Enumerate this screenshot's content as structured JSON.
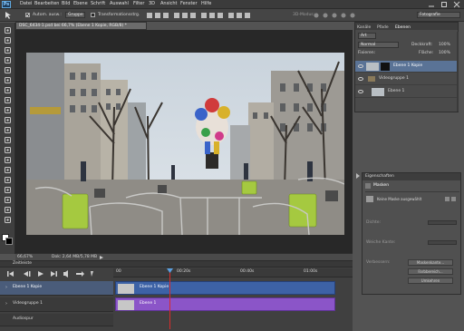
{
  "app": {
    "logo": "Ps"
  },
  "menubar": {
    "items": [
      "Datei",
      "Bearbeiten",
      "Bild",
      "Ebene",
      "Schrift",
      "Auswahl",
      "Filter",
      "3D",
      "Ansicht",
      "Fenster",
      "Hilfe"
    ]
  },
  "options": {
    "auto_select_label": "Autom. ausw.:",
    "auto_select_value": "Gruppe",
    "transform_label": "Transformationsstrg.",
    "mode_3d": "3D-Modus:",
    "workspace": "Fotografie"
  },
  "document": {
    "tab_title": "DSC_6434-1.psd bei 66,7% (Ebene 1 Kopie, RGB/8) *",
    "zoom": "66,67%",
    "doc_size": "Dok: 2,64 MB/5,78 MB"
  },
  "timeline": {
    "title": "Zeitleiste",
    "time_marks": [
      "00",
      "00:20s",
      "00:40s",
      "01:00s"
    ],
    "tracks": [
      {
        "name": "Ebene 1 Kopie",
        "clip": "Ebene 1 Kopie"
      },
      {
        "name": "Videogruppe 1",
        "clip": "Ebene 1"
      },
      {
        "name": "Audiospur",
        "clip": ""
      }
    ]
  },
  "panels": {
    "tabs": [
      "Kanäle",
      "Pfade",
      "Ebenen"
    ],
    "filter_kind": "Art",
    "blend_mode": "Normal",
    "opacity_label": "Deckkraft:",
    "opacity_value": "100%",
    "lock_label": "Fixieren:",
    "fill_label": "Fläche:",
    "fill_value": "100%",
    "layers": [
      {
        "name": "Ebene 1 Kopie",
        "selected": true
      },
      {
        "name": "Videogruppe 1",
        "selected": false
      },
      {
        "name": "Ebene 1",
        "selected": false
      }
    ]
  },
  "properties": {
    "title": "Eigenschaften",
    "tab": "Masken",
    "no_mask": "Keine Maske ausgewählt",
    "density_label": "Dichte:",
    "feather_label": "Weiche Kante:",
    "refine_label": "Verbessern:",
    "buttons": [
      "Maskenkante...",
      "Farbbereich...",
      "Umkehren"
    ]
  },
  "colors": {
    "accent_blue": "#3d62a6",
    "clip_purple": "#8b55c8",
    "playhead": "#d92b2b"
  }
}
